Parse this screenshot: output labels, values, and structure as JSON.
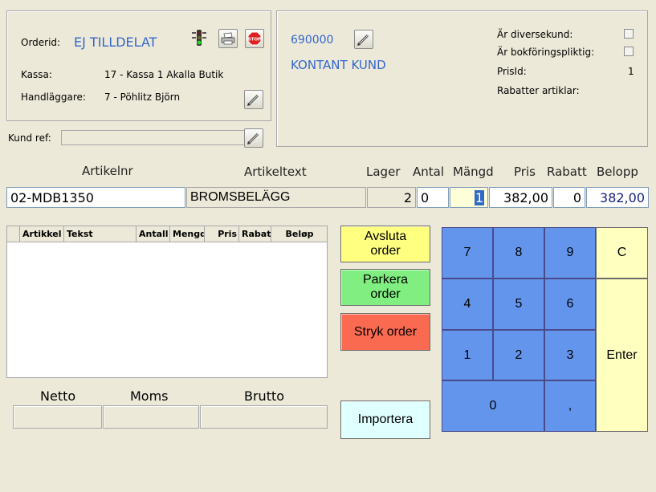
{
  "order": {
    "orderid_label": "Orderid:",
    "orderid_value": "EJ TILLDELAT",
    "kassa_label": "Kassa:",
    "kassa_value": "17 - Kassa 1 Akalla Butik",
    "handlaggare_label": "Handläggare:",
    "handlaggare_value": "7 - Pöhlitz Björn",
    "stop_text": "STOP"
  },
  "kundref": {
    "label": "Kund ref:",
    "value": ""
  },
  "customer": {
    "number": "690000",
    "name": "KONTANT KUND",
    "diversekund_label": "Är diversekund:",
    "bokforing_label": "Är bokföringspliktig:",
    "prisid_label": "PrisId:",
    "prisid_value": "1",
    "rabatter_label": "Rabatter artiklar:",
    "diversekund_checked": false,
    "bokforing_checked": false
  },
  "entry": {
    "headers": {
      "artikelnr": "Artikelnr",
      "artikeltext": "Artikeltext",
      "lager": "Lager",
      "antal": "Antal",
      "mangd": "Mängd",
      "pris": "Pris",
      "rabatt": "Rabatt",
      "belopp": "Belopp"
    },
    "artikelnr": "02-MDB1350",
    "artikeltext": "BROMSBELÄGG",
    "lager": "2",
    "antal": "0",
    "mangd": "1",
    "pris": "382,00",
    "rabatt": "0",
    "belopp": "382,00"
  },
  "grid": {
    "columns": [
      "Artikkel",
      "Tekst",
      "Antall",
      "Mengd",
      "Pris",
      "Rabat",
      "Beløp"
    ]
  },
  "totals": {
    "netto_label": "Netto",
    "moms_label": "Moms",
    "brutto_label": "Brutto",
    "netto": "",
    "moms": "",
    "brutto": ""
  },
  "actions": {
    "avsluta": "Avsluta order",
    "parkera": "Parkera order",
    "stryk": "Stryk order",
    "importera": "Importera"
  },
  "keypad": {
    "k7": "7",
    "k8": "8",
    "k9": "9",
    "clear": "C",
    "k4": "4",
    "k5": "5",
    "k6": "6",
    "k1": "1",
    "k2": "2",
    "k3": "3",
    "enter": "Enter",
    "k0": "0",
    "comma": ","
  },
  "colors": {
    "accent_blue": "#3366cc",
    "keypad_blue": "#6495ed",
    "keypad_yellow": "#ffffc0",
    "avsluta_bg": "#ffff80",
    "parkera_bg": "#80ee80",
    "stryk_bg": "#fa6a50",
    "importera_bg": "#e0ffff"
  },
  "icons": {
    "traffic_light": "traffic-light-icon",
    "print": "printer-icon",
    "stop": "stop-sign-icon",
    "edit": "pencil-icon"
  }
}
